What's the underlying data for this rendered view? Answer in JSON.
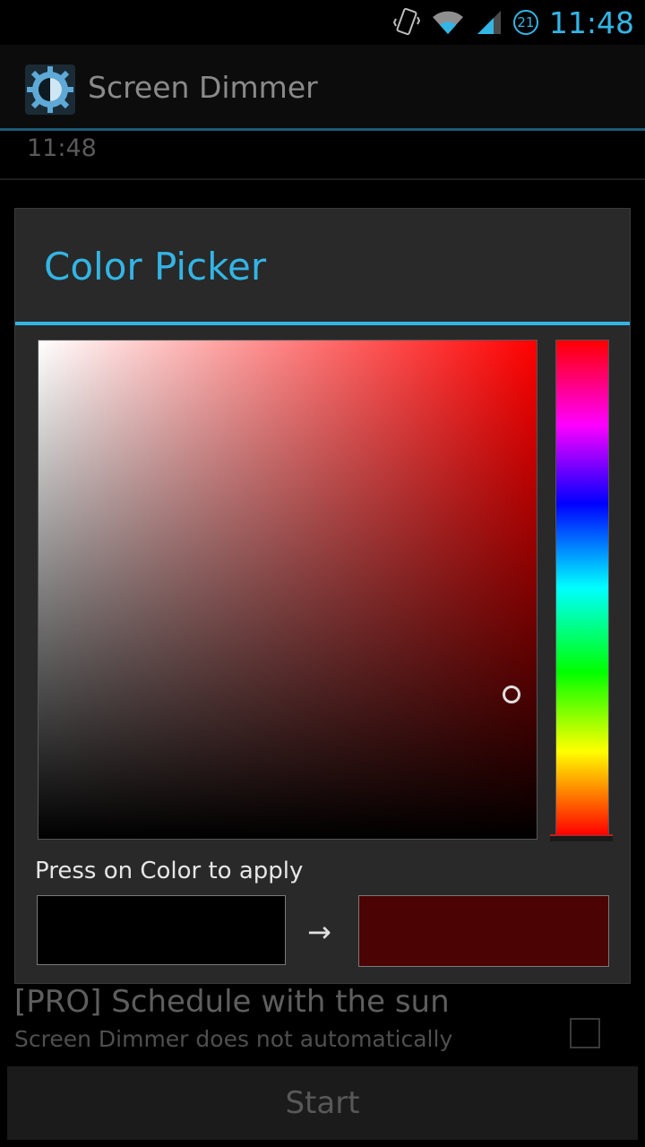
{
  "status_bar": {
    "time": "11:48",
    "notification_badge": "21",
    "icons": [
      "vibrate-icon",
      "wifi-icon",
      "signal-icon"
    ]
  },
  "action_bar": {
    "title": "Screen Dimmer",
    "icon": "sun-gear-icon"
  },
  "background": {
    "time_row": "11:48",
    "pro_sun": {
      "title": "[PRO] Schedule with the sun",
      "description": "Screen Dimmer does not automatically"
    },
    "start_button": "Start"
  },
  "dialog": {
    "title": "Color Picker",
    "apply_label": "Press on Color to apply",
    "arrow": "→",
    "hue_color": "#ff0000",
    "saturation": 0.95,
    "value": 0.29,
    "old_color": "#000000",
    "new_color": "#4b0303"
  },
  "colors": {
    "accent": "#33b5e5"
  }
}
